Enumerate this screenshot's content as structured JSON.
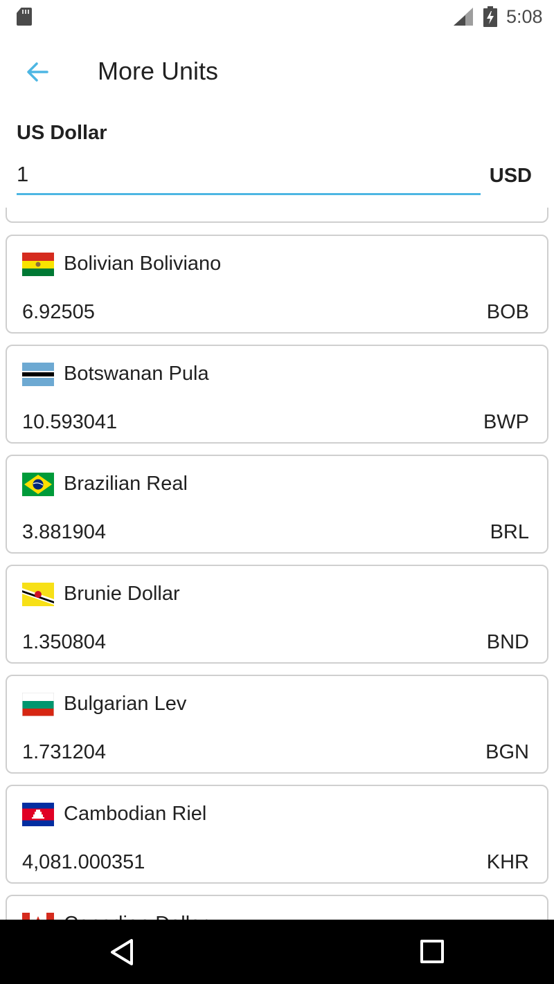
{
  "status_bar": {
    "time": "5:08",
    "icons": [
      "sd-card-icon",
      "signal-icon",
      "battery-charging-icon"
    ]
  },
  "app_bar": {
    "title": "More Units",
    "back_icon": "arrow-back-icon",
    "accent_color": "#4db6e3"
  },
  "base": {
    "label": "US Dollar",
    "amount": "1",
    "code": "USD"
  },
  "currencies": [
    {
      "name": "",
      "value": "",
      "code": "",
      "flag": "none"
    },
    {
      "name": "Bolivian Boliviano",
      "value": "6.92505",
      "code": "BOB",
      "flag": "bolivia-flag-icon"
    },
    {
      "name": "Botswanan Pula",
      "value": "10.593041",
      "code": "BWP",
      "flag": "botswana-flag-icon"
    },
    {
      "name": "Brazilian Real",
      "value": "3.881904",
      "code": "BRL",
      "flag": "brazil-flag-icon"
    },
    {
      "name": "Brunie Dollar",
      "value": "1.350804",
      "code": "BND",
      "flag": "brunei-flag-icon"
    },
    {
      "name": "Bulgarian Lev",
      "value": "1.731204",
      "code": "BGN",
      "flag": "bulgaria-flag-icon"
    },
    {
      "name": "Cambodian Riel",
      "value": "4,081.000351",
      "code": "KHR",
      "flag": "cambodia-flag-icon"
    },
    {
      "name": "Canadian Dollar",
      "value": "",
      "code": "",
      "flag": "canada-flag-icon"
    }
  ],
  "nav_bar": {
    "icons": [
      "nav-back-icon",
      "nav-recents-icon"
    ]
  }
}
